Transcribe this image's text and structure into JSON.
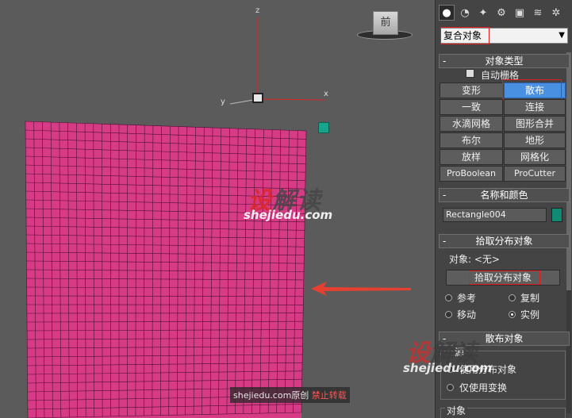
{
  "viewport": {
    "axis_labels": {
      "z": "z",
      "x": "x",
      "y": "y"
    },
    "viewcube_label": "前",
    "watermark": {
      "logo_red": "设",
      "logo_rest": "解读",
      "site": "shejiedu.com"
    },
    "credit": {
      "site": "shejiedu.com",
      "original": "原创",
      "forbid": "禁止转载"
    },
    "plane_color": "#d83b86"
  },
  "panel": {
    "tabs": [
      {
        "icon": "sphere-icon"
      },
      {
        "icon": "shapes-icon"
      },
      {
        "icon": "light-icon"
      },
      {
        "icon": "camera-icon"
      },
      {
        "icon": "helper-icon"
      },
      {
        "icon": "spacewarp-icon"
      },
      {
        "icon": "systems-icon"
      }
    ],
    "category_dropdown": "复合对象",
    "object_type": {
      "title": "对象类型",
      "autogrid": "自动栅格",
      "buttons": [
        "变形",
        "散布",
        "一致",
        "连接",
        "水滴网格",
        "图形合并",
        "布尔",
        "地形",
        "放样",
        "网格化",
        "ProBoolean",
        "ProCutter"
      ],
      "selected": "散布"
    },
    "name_color": {
      "title": "名称和颜色",
      "name": "Rectangle004",
      "color": "#0f8a73"
    },
    "pick_distribution": {
      "title": "拾取分布对象",
      "object_label": "对象: <无>",
      "pick_button": "拾取分布对象",
      "radios": [
        {
          "label": "参考",
          "on": false
        },
        {
          "label": "复制",
          "on": false
        },
        {
          "label": "移动",
          "on": false
        },
        {
          "label": "实例",
          "on": true
        }
      ]
    },
    "scatter_objects": {
      "title": "散布对象",
      "group_label": "源",
      "opt1": "使用分布对象",
      "opt2": "仅使用变换",
      "objects_label": "对象"
    }
  }
}
